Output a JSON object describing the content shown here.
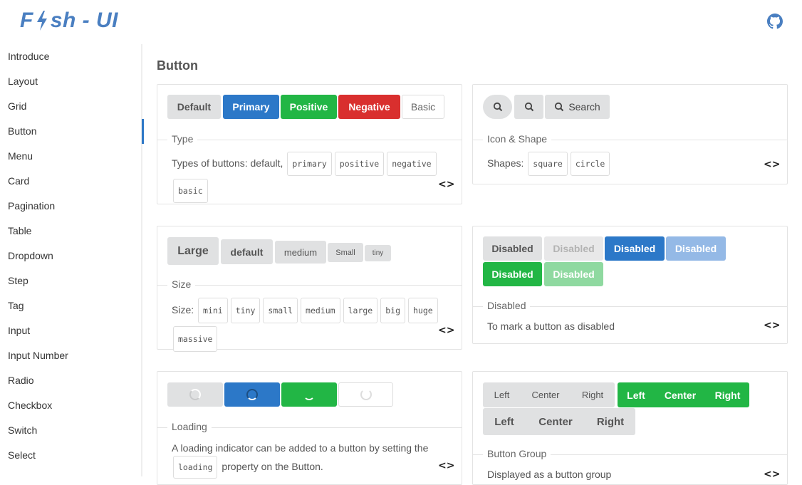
{
  "header": {
    "logo_prefix": "F",
    "logo_suffix": "sh - UI"
  },
  "sidebar": {
    "items": [
      {
        "label": "Introduce"
      },
      {
        "label": "Layout"
      },
      {
        "label": "Grid"
      },
      {
        "label": "Button"
      },
      {
        "label": "Menu"
      },
      {
        "label": "Card"
      },
      {
        "label": "Pagination"
      },
      {
        "label": "Table"
      },
      {
        "label": "Dropdown"
      },
      {
        "label": "Step"
      },
      {
        "label": "Tag"
      },
      {
        "label": "Input"
      },
      {
        "label": "Input Number"
      },
      {
        "label": "Radio"
      },
      {
        "label": "Checkbox"
      },
      {
        "label": "Switch"
      },
      {
        "label": "Select"
      }
    ]
  },
  "main": {
    "title": "Button",
    "type_card": {
      "buttons": [
        "Default",
        "Primary",
        "Positive",
        "Negative",
        "Basic"
      ],
      "legend": "Type",
      "desc": "Types of buttons: default,",
      "codes": [
        "primary",
        "positive",
        "negative",
        "basic"
      ],
      "toggle": "<>"
    },
    "icon_card": {
      "search_label": "Search",
      "legend": "Icon & Shape",
      "desc": "Shapes:",
      "codes": [
        "square",
        "circle"
      ],
      "toggle": "<>"
    },
    "size_card": {
      "buttons": [
        "Large",
        "default",
        "medium",
        "Small",
        "tiny"
      ],
      "legend": "Size",
      "desc": "Size:",
      "codes": [
        "mini",
        "tiny",
        "small",
        "medium",
        "large",
        "big",
        "huge",
        "massive"
      ],
      "toggle": "<>"
    },
    "disabled_card": {
      "buttons": [
        "Disabled",
        "Disabled",
        "Disabled",
        "Disabled",
        "Disabled",
        "Disabled"
      ],
      "legend": "Disabled",
      "desc": "To mark a button as disabled",
      "toggle": "<>"
    },
    "loading_card": {
      "legend": "Loading",
      "desc_line1": "A loading indicator can be added to a button by setting the",
      "code": "loading",
      "desc_line2": "property on the Button.",
      "toggle": "<>"
    },
    "group_card": {
      "group1": [
        "Left",
        "Center",
        "Right"
      ],
      "group2": [
        "Left",
        "Center",
        "Right"
      ],
      "group3": [
        "Left",
        "Center",
        "Right"
      ],
      "legend": "Button Group",
      "desc": "Displayed as a button group",
      "toggle": "<>"
    }
  },
  "colors": {
    "primary": "#2c78c8",
    "positive": "#22b645",
    "negative": "#d92f2e",
    "logo": "#4a7fc1",
    "active_indicator": "#2e78c7"
  },
  "icons": [
    "bolt-icon",
    "github-icon",
    "search-icon",
    "spinner-icon"
  ]
}
